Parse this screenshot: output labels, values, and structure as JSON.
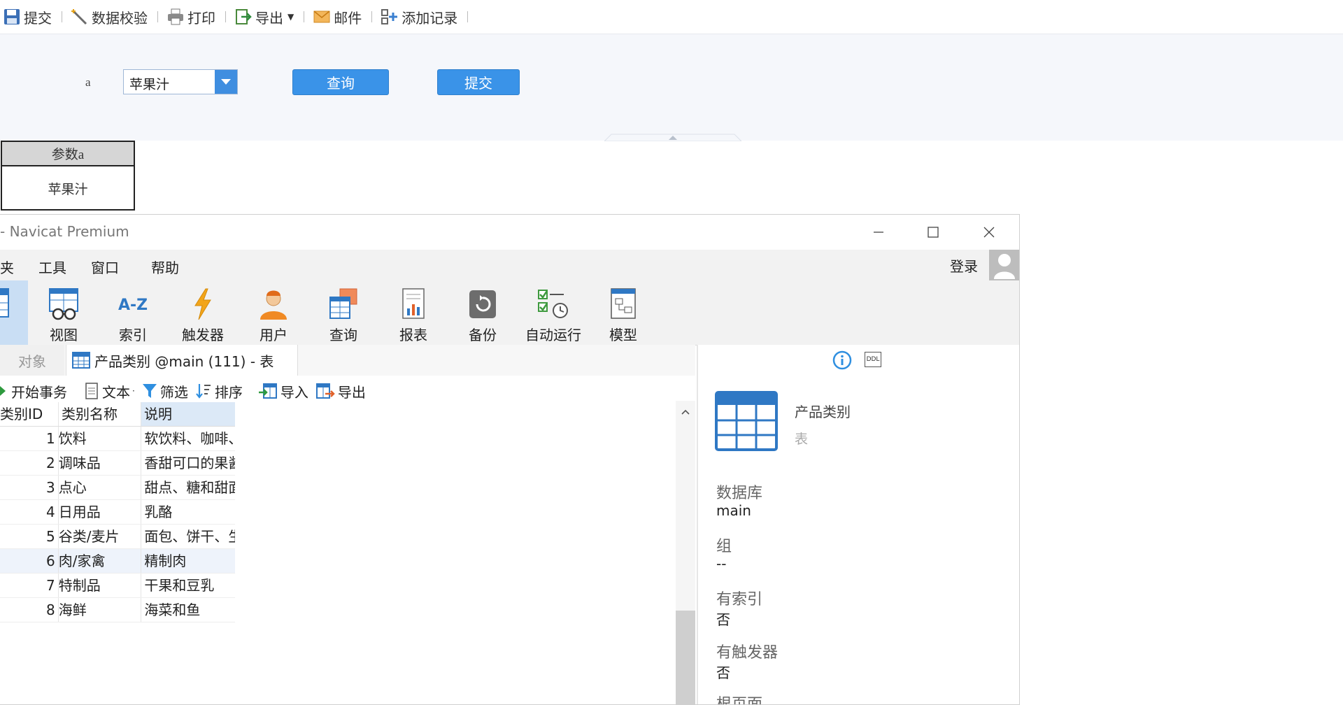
{
  "report_toolbar": {
    "items": [
      {
        "label": "提交",
        "icon": "save-icon"
      },
      {
        "label": "数据校验",
        "icon": "wand-icon"
      },
      {
        "label": "打印",
        "icon": "printer-icon"
      },
      {
        "label": "导出",
        "icon": "export-icon"
      },
      {
        "label": "邮件",
        "icon": "mail-icon"
      },
      {
        "label": "添加记录",
        "icon": "add-record-icon"
      }
    ]
  },
  "param_form": {
    "label": "a",
    "combo_value": "苹果汁",
    "query_button": "查询",
    "submit_button": "提交"
  },
  "result_table": {
    "header": "参数a",
    "value": "苹果汁"
  },
  "navicat": {
    "title": "- Navicat Premium",
    "menu": [
      "夹",
      "工具",
      "窗口",
      "帮助"
    ],
    "login": "登录",
    "ribbon": [
      {
        "label": "视图",
        "icon": "view-icon"
      },
      {
        "label": "索引",
        "icon": "index-az-icon"
      },
      {
        "label": "触发器",
        "icon": "trigger-bolt-icon"
      },
      {
        "label": "用户",
        "icon": "user-icon"
      },
      {
        "label": "查询",
        "icon": "query-table-icon"
      },
      {
        "label": "报表",
        "icon": "report-icon"
      },
      {
        "label": "备份",
        "icon": "backup-icon"
      },
      {
        "label": "自动运行",
        "icon": "auto-run-icon"
      },
      {
        "label": "模型",
        "icon": "model-icon"
      }
    ],
    "tabs": {
      "objects": "对象",
      "table_tab": "产品类别 @main (111) - 表"
    },
    "table_toolbar": {
      "begin_tx": "开始事务",
      "text": "文本",
      "filter": "筛选",
      "sort": "排序",
      "import": "导入",
      "export": "导出"
    },
    "grid": {
      "columns": [
        "类别ID",
        "类别名称",
        "说明"
      ],
      "rows": [
        {
          "id": "1",
          "name": "饮料",
          "desc": "软饮料、咖啡、"
        },
        {
          "id": "2",
          "name": "调味品",
          "desc": "香甜可口的果酱"
        },
        {
          "id": "3",
          "name": "点心",
          "desc": "甜点、糖和甜面"
        },
        {
          "id": "4",
          "name": "日用品",
          "desc": "乳酪"
        },
        {
          "id": "5",
          "name": "谷类/麦片",
          "desc": "面包、饼干、生"
        },
        {
          "id": "6",
          "name": "肉/家禽",
          "desc": "精制肉"
        },
        {
          "id": "7",
          "name": "特制品",
          "desc": "干果和豆乳"
        },
        {
          "id": "8",
          "name": "海鲜",
          "desc": "海菜和鱼"
        }
      ]
    },
    "info_panel": {
      "ddl_badge": "DDL",
      "object_name": "产品类别",
      "object_type": "表",
      "fields": [
        {
          "label": "数据库",
          "value": "main"
        },
        {
          "label": "组",
          "value": "--"
        },
        {
          "label": "有索引",
          "value": "否"
        },
        {
          "label": "有触发器",
          "value": "否"
        },
        {
          "label": "根页面",
          "value": ""
        }
      ]
    }
  },
  "colors": {
    "accent_blue": "#3a93e8",
    "selected_ribbon": "#c9def4",
    "param_bg": "#f5f7fb"
  }
}
